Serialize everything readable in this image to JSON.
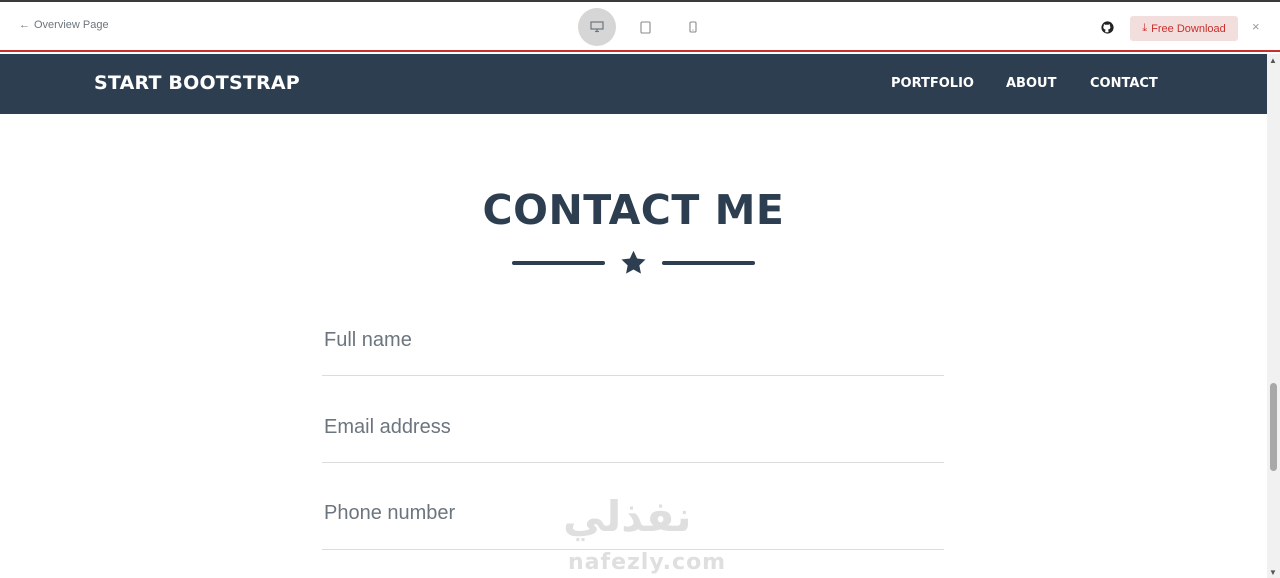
{
  "preview_bar": {
    "back_label": "Overview Page",
    "download_label": "Free Download",
    "devices": [
      "desktop-icon",
      "tablet-icon",
      "mobile-icon"
    ],
    "active_device": "desktop"
  },
  "navbar": {
    "brand": "START BOOTSTRAP",
    "items": [
      "PORTFOLIO",
      "ABOUT",
      "CONTACT"
    ]
  },
  "contact": {
    "heading": "CONTACT ME",
    "fields": {
      "name_placeholder": "Full name",
      "email_placeholder": "Email address",
      "phone_placeholder": "Phone number"
    }
  },
  "watermark": {
    "arabic": "نفذلي",
    "latin": "nafezly.com"
  },
  "colors": {
    "navbar_bg": "#2c3e50",
    "heading": "#2c3e50",
    "accent_red": "#c9302c"
  }
}
